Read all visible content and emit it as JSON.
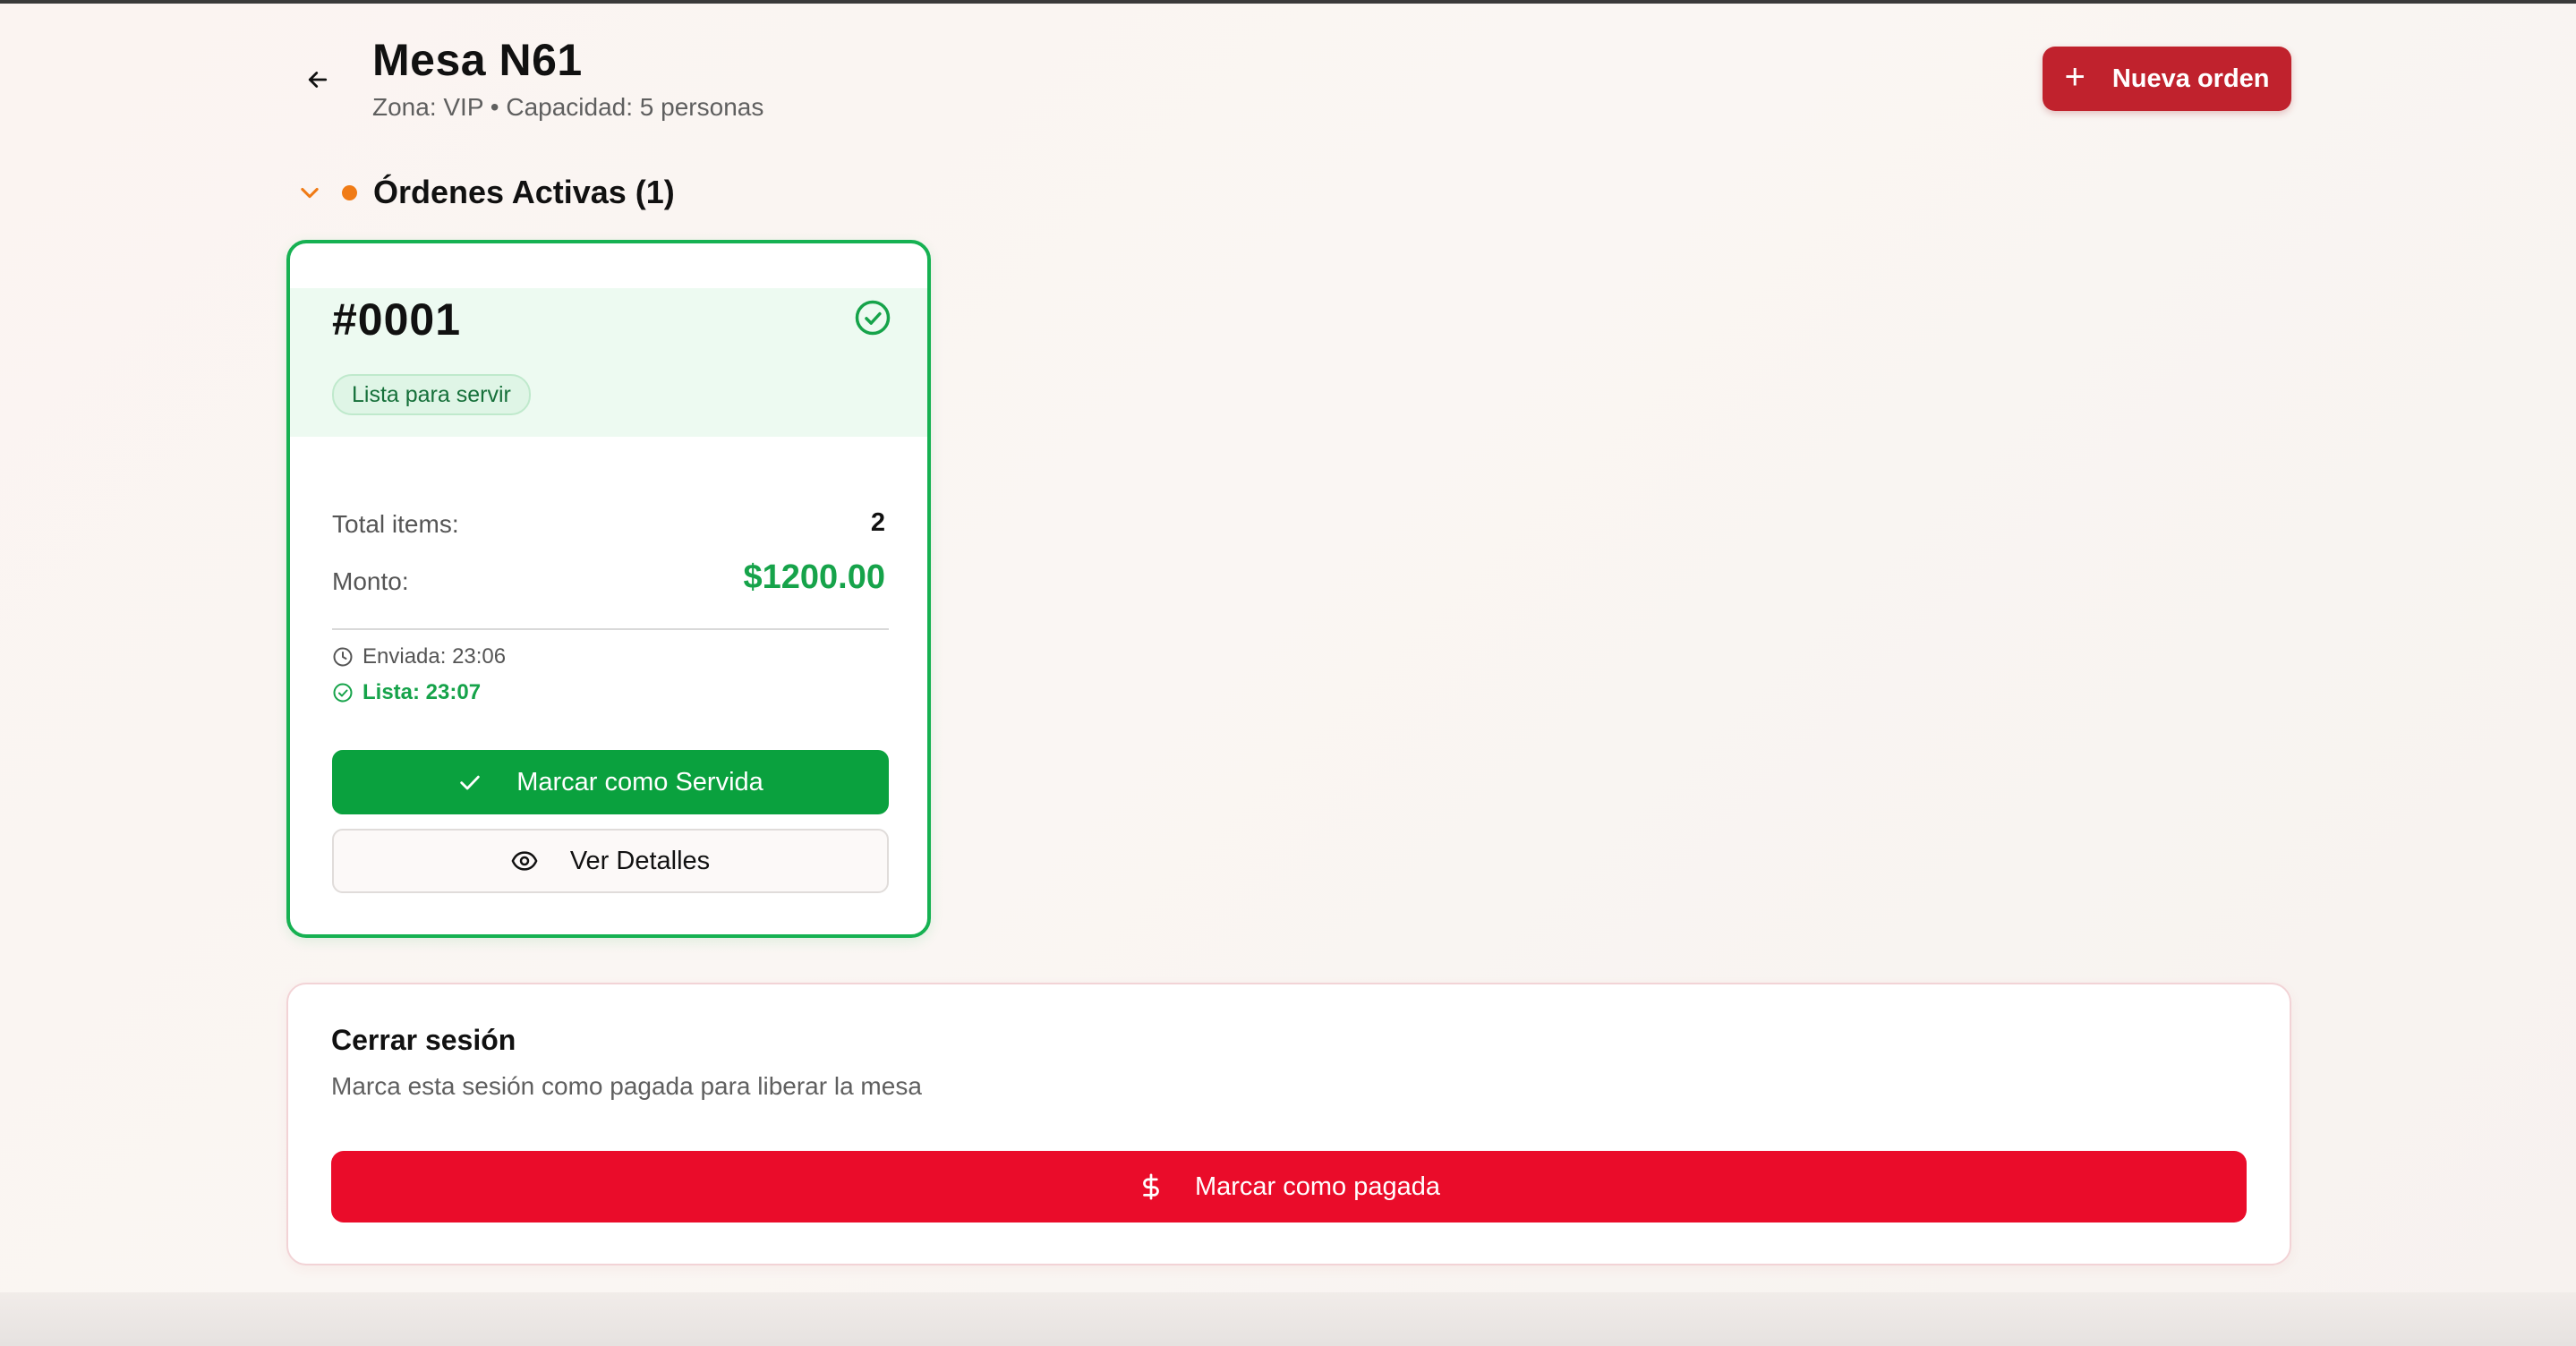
{
  "header": {
    "title": "Mesa N61",
    "subtitle": "Zona: VIP • Capacidad: 5 personas",
    "new_order_label": "Nueva orden"
  },
  "orders_section": {
    "title": "Órdenes Activas (1)"
  },
  "order_card": {
    "number": "#0001",
    "status": "Lista para servir",
    "total_items_label": "Total items:",
    "total_items_value": "2",
    "amount_label": "Monto:",
    "amount_value": "$1200.00",
    "sent_time": "Enviada: 23:06",
    "ready_time": "Lista: 23:07",
    "serve_button_label": "Marcar como Servida",
    "details_button_label": "Ver Detalles"
  },
  "close_session": {
    "title": "Cerrar sesión",
    "description": "Marca esta sesión como pagada para liberar la mesa",
    "pay_button_label": "Marcar como pagada"
  },
  "icons": {
    "back": "arrow-left-icon",
    "new_order": "plus-icon",
    "collapse": "chevron-down-icon",
    "ready": "check-circle-icon",
    "sent_time": "clock-icon",
    "ready_time": "check-circle-icon",
    "serve": "check-icon",
    "details": "eye-icon",
    "pay": "dollar-icon"
  },
  "colors": {
    "primary_red": "#c0222d",
    "pay_red": "#ea0c2a",
    "success_green": "#16a34a",
    "card_border": "#16b152",
    "status_dot": "#f07b16"
  }
}
